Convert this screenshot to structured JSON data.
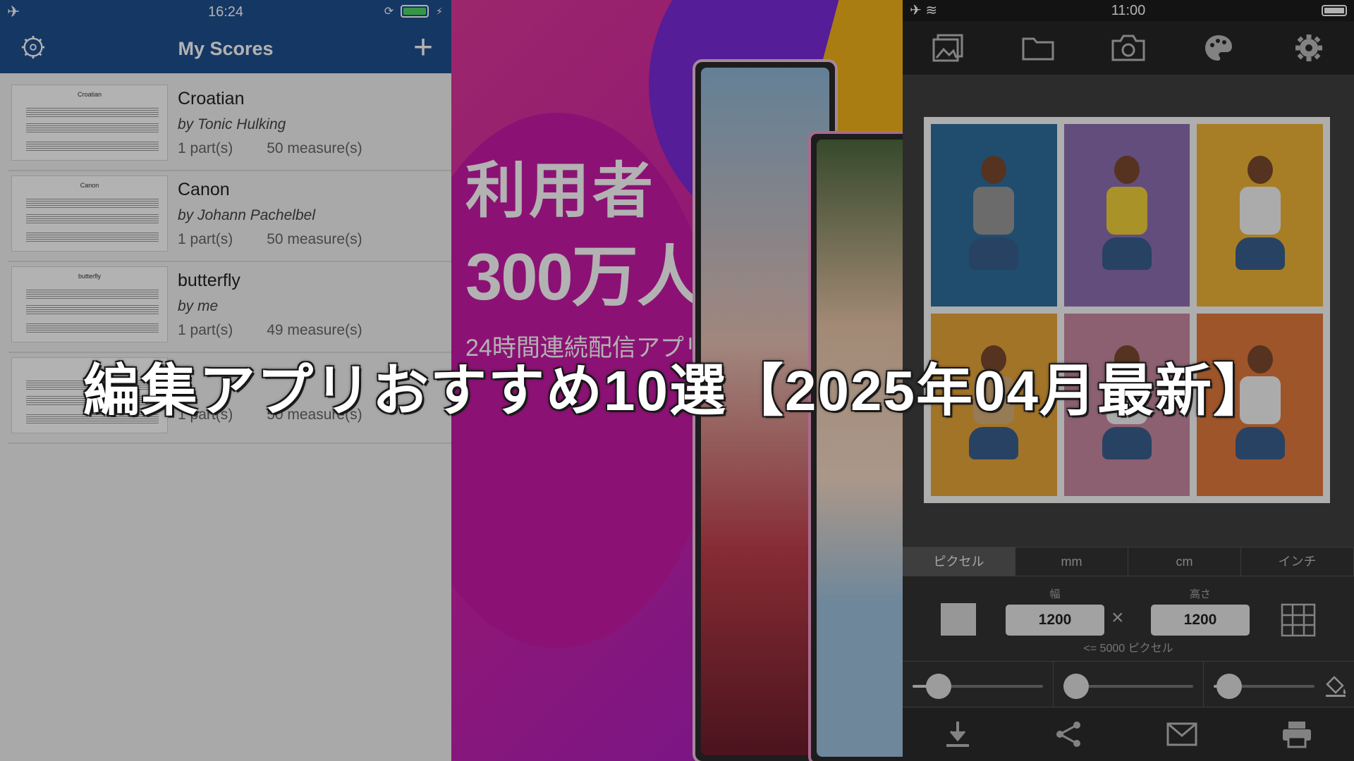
{
  "left_panel": {
    "status_time": "16:24",
    "title": "My Scores",
    "scores": [
      {
        "title": "Croatian",
        "author": "by Tonic Hulking",
        "parts": "1 part(s)",
        "measures": "50 measure(s)"
      },
      {
        "title": "Canon",
        "author": "by Johann Pachelbel",
        "parts": "1 part(s)",
        "measures": "50 measure(s)"
      },
      {
        "title": "butterfly",
        "author": "by me",
        "parts": "1 part(s)",
        "measures": "49 measure(s)"
      },
      {
        "title": "",
        "author": "",
        "parts": "1 part(s)",
        "measures": "50 measure(s)"
      }
    ],
    "battery_level": 1.0,
    "accent_color": "#1f4f8f"
  },
  "middle_panel": {
    "headline_line1": "利用者",
    "headline_line2": "300万人超え!",
    "subline": "24時間連続配信アプリ"
  },
  "right_panel": {
    "status_time": "11:00",
    "toolbar_icons": [
      "photo-library-icon",
      "folder-icon",
      "camera-icon",
      "palette-icon",
      "gear-icon"
    ],
    "unit_tabs": [
      "ピクセル",
      "mm",
      "cm",
      "インチ"
    ],
    "active_tab_index": 0,
    "width_label": "幅",
    "height_label": "高さ",
    "width_value": "1200",
    "height_value": "1200",
    "times_symbol": "×",
    "limit_note": "<= 5000 ピクセル",
    "slider_values": [
      0.2,
      0.1,
      0.15
    ],
    "tile_colors": [
      "#2e6f9e",
      "#8e6fb3",
      "#f0b535",
      "#e8a73a",
      "#c98aa1",
      "#e37a3b"
    ],
    "action_icons": [
      "download-icon",
      "share-icon",
      "mail-icon",
      "print-icon"
    ]
  },
  "overlay": {
    "title": "編集アプリおすすめ10選【2025年04月最新】"
  }
}
